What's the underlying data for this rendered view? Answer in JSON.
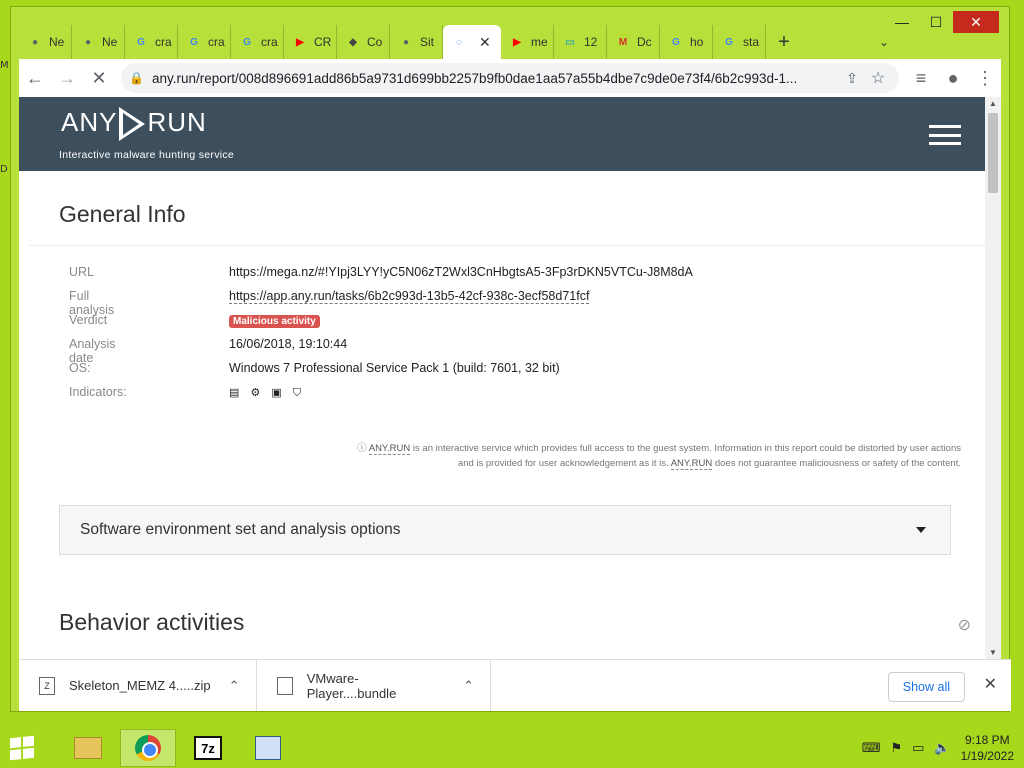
{
  "window": {
    "minimize": "—",
    "maximize": "☐",
    "close": "✕"
  },
  "tabs": [
    {
      "label": "Ne",
      "icon": "●",
      "color": "#5f6368"
    },
    {
      "label": "Ne",
      "icon": "●",
      "color": "#5f6368"
    },
    {
      "label": "cra",
      "icon": "G",
      "color": "#4285f4"
    },
    {
      "label": "cra",
      "icon": "G",
      "color": "#4285f4"
    },
    {
      "label": "cra",
      "icon": "G",
      "color": "#4285f4"
    },
    {
      "label": "CR",
      "icon": "▶",
      "color": "#ff0000"
    },
    {
      "label": "Co",
      "icon": "◆",
      "color": "#444"
    },
    {
      "label": "Sit",
      "icon": "●",
      "color": "#5f6368"
    },
    {
      "label": "",
      "icon": "◌",
      "color": "#1a73e8",
      "active": true
    },
    {
      "label": "me",
      "icon": "▶",
      "color": "#ff0000"
    },
    {
      "label": "12",
      "icon": "▭",
      "color": "#3aa"
    },
    {
      "label": "Dc",
      "icon": "M",
      "color": "#d93025"
    },
    {
      "label": "ho",
      "icon": "G",
      "color": "#4285f4"
    },
    {
      "label": "sta",
      "icon": "G",
      "color": "#4285f4"
    }
  ],
  "toolbar": {
    "back": "←",
    "forward": "→",
    "stop": "✕",
    "url": "any.run/report/008d896691add86b5a9731d699bb2257b9fb0dae1aa57a55b4dbe7c9de0e73f4/6b2c993d-1...",
    "share": "⇪",
    "bookmark": "☆",
    "media": "≡",
    "profile": "●",
    "menu": "⋮",
    "new_tab": "+",
    "tab_search": "⌄"
  },
  "site": {
    "logo_left": "ANY",
    "logo_right": "RUN",
    "tagline": "Interactive malware hunting service"
  },
  "general": {
    "title": "General Info",
    "rows": [
      {
        "label": "URL",
        "value": "https://mega.nz/#!YIpj3LYY!yC5N06zT2Wxl3CnHbgtsA5-3Fp3rDKN5VTCu-J8M8dA"
      },
      {
        "label": "Full analysis",
        "value": "https://app.any.run/tasks/6b2c993d-13b5-42cf-938c-3ecf58d71fcf"
      },
      {
        "label": "Verdict",
        "value": "Malicious activity"
      },
      {
        "label": "Analysis date",
        "value": "16/06/2018, 19:10:44"
      },
      {
        "label": "OS:",
        "value": "Windows 7 Professional Service Pack 1 (build: 7601, 32 bit)"
      },
      {
        "label": "Indicators:",
        "value": "▤ ⚙ ▣ ⛉"
      }
    ]
  },
  "disclaimer": {
    "icon": "ⓘ",
    "brand": "ANY.RUN",
    "text1": " is an interactive service which provides full access to the guest system. Information in this report could be distorted by user actions and is provided for user acknowledgement as it is. ",
    "brand2": "ANY.RUN",
    "text2": " does not guarantee maliciousness or safety of the content."
  },
  "accordion": {
    "label": "Software environment set and analysis options"
  },
  "behavior": {
    "title": "Behavior activities",
    "eye_icon": "⊘"
  },
  "downloads": {
    "items": [
      {
        "name": "Skeleton_MEMZ 4.....zip",
        "icon": "Z"
      },
      {
        "name": "VMware-Player....bundle",
        "icon": ""
      }
    ],
    "show_all": "Show all",
    "close": "✕"
  },
  "taskbar": {
    "time": "9:18 PM",
    "date": "1/19/2022",
    "sz_label": "7z",
    "tray": [
      "⌨",
      "⚑",
      "▭",
      "🔈"
    ]
  }
}
